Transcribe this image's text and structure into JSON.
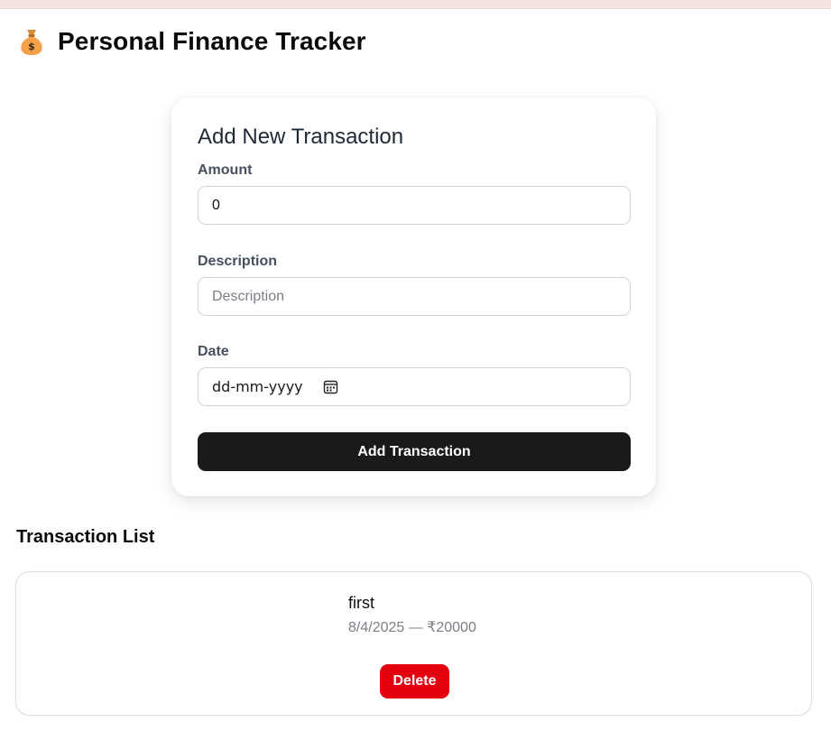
{
  "header": {
    "icon": "money-bag-icon",
    "title": "Personal Finance Tracker"
  },
  "form": {
    "title": "Add New Transaction",
    "amount": {
      "label": "Amount",
      "value": "0"
    },
    "description": {
      "label": "Description",
      "placeholder": "Description",
      "value": ""
    },
    "date": {
      "label": "Date",
      "placeholder": "dd-mm-yyyy",
      "icon": "calendar-icon"
    },
    "submit_label": "Add Transaction"
  },
  "transactions": {
    "heading": "Transaction List",
    "items": [
      {
        "description": "first",
        "meta": "8/4/2025 — ₹20000",
        "delete_label": "Delete"
      }
    ]
  },
  "colors": {
    "top_strip": "#f3e4e2",
    "primary_button": "#1a1a1a",
    "delete_button": "#e3000f",
    "label_text": "#475060"
  }
}
